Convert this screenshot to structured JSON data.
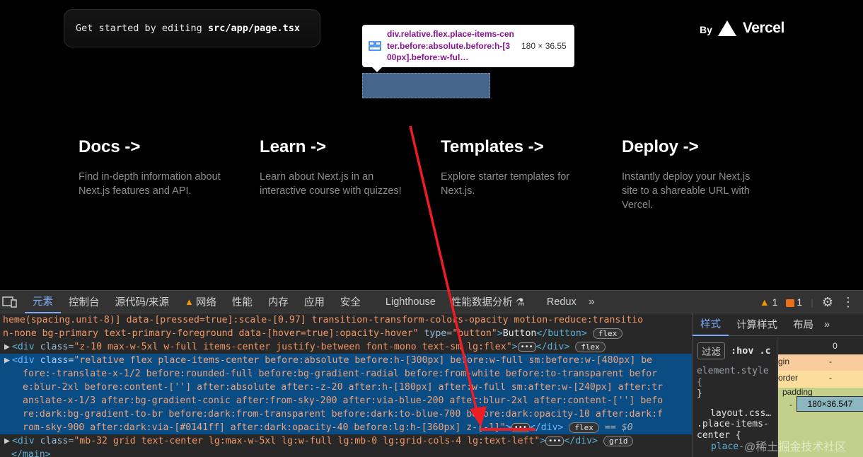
{
  "page": {
    "get_started": {
      "prefix": "Get started by editing ",
      "file": "src/app/page.tsx"
    },
    "by_label": "By",
    "brand": "Vercel",
    "inspect_tooltip": {
      "selector": "div.relative.flex.place-items-center.before:absolute.before:h-[300px].before:w-ful…",
      "size": "180 × 36.55"
    },
    "cards": [
      {
        "title": "Docs ->",
        "desc": "Find in-depth information about Next.js features and API."
      },
      {
        "title": "Learn ->",
        "desc": "Learn about Next.js in an interactive course with quizzes!"
      },
      {
        "title": "Templates ->",
        "desc": "Explore starter templates for Next.js."
      },
      {
        "title": "Deploy ->",
        "desc": "Instantly deploy your Next.js site to a shareable URL with Vercel."
      }
    ]
  },
  "devtools": {
    "tabs": [
      "元素",
      "控制台",
      "源代码/来源",
      "网络",
      "性能",
      "内存",
      "应用",
      "安全",
      "Lighthouse",
      "性能数据分析 ⚗",
      "Redux"
    ],
    "more": "»",
    "warnings": "1",
    "issues": "1",
    "elements_lines": [
      "heme(spacing.unit-8)] data-[pressed=true]:scale-[0.97] transition-transform-colors-opacity motion-reduce:transitio",
      "n-none bg-primary text-primary-foreground data-[hover=true]:opacity-hover\" type=\"button\">Button</button>"
    ],
    "line3": {
      "class": "z-10 max-w-5xl w-full items-center justify-between font-mono text-sm lg:flex",
      "badge": "flex"
    },
    "selected": {
      "lines": [
        "relative flex place-items-center before:absolute before:h-[300px] before:w-full sm:before:w-[480px] be",
        "fore:-translate-x-1/2 before:rounded-full before:bg-gradient-radial before:from-white before:to-transparent befor",
        "e:blur-2xl before:content-[''] after:absolute after:-z-20 after:h-[180px] after:w-full sm:after:w-[240px] after:tr",
        "anslate-x-1/3 after:bg-gradient-conic after:from-sky-200 after:via-blue-200 after:blur-2xl after:content-[''] befo",
        "re:dark:bg-gradient-to-br before:dark:from-transparent before:dark:to-blue-700 before:dark:opacity-10 after:dark:f",
        "rom-sky-900 after:dark:via-[#0141ff] after:dark:opacity-40 before:lg:h-[360px] z-[-1]"
      ],
      "badge": "flex",
      "dollar": "== $0"
    },
    "line_grid": {
      "class": "mb-32 grid text-center lg:max-w-5xl lg:w-full lg:mb-0 lg:grid-cols-4 lg:text-left",
      "badge": "grid"
    },
    "line_main_close": "</main>",
    "side_tabs": [
      "样式",
      "计算样式",
      "布局"
    ],
    "filter": "过滤",
    "hov": ":hov",
    "cls": ".c",
    "element_style": "element.style {",
    "element_style_close": "}",
    "rule_source": "layout.css…",
    "rule_selector": ".place-items-center {",
    "rule_prop": "place-",
    "box_model": {
      "position": "0",
      "margin": "margin",
      "margin_value": "-",
      "border": "border",
      "border_value": "-",
      "padding": "padding",
      "padding_value": "-",
      "content": "180×36.547"
    },
    "watermark": "@稀土掘金技术社区"
  },
  "colors": {
    "accent": "#7cacf8",
    "selection": "#0a4c84",
    "annotation": "#ee1c25"
  }
}
